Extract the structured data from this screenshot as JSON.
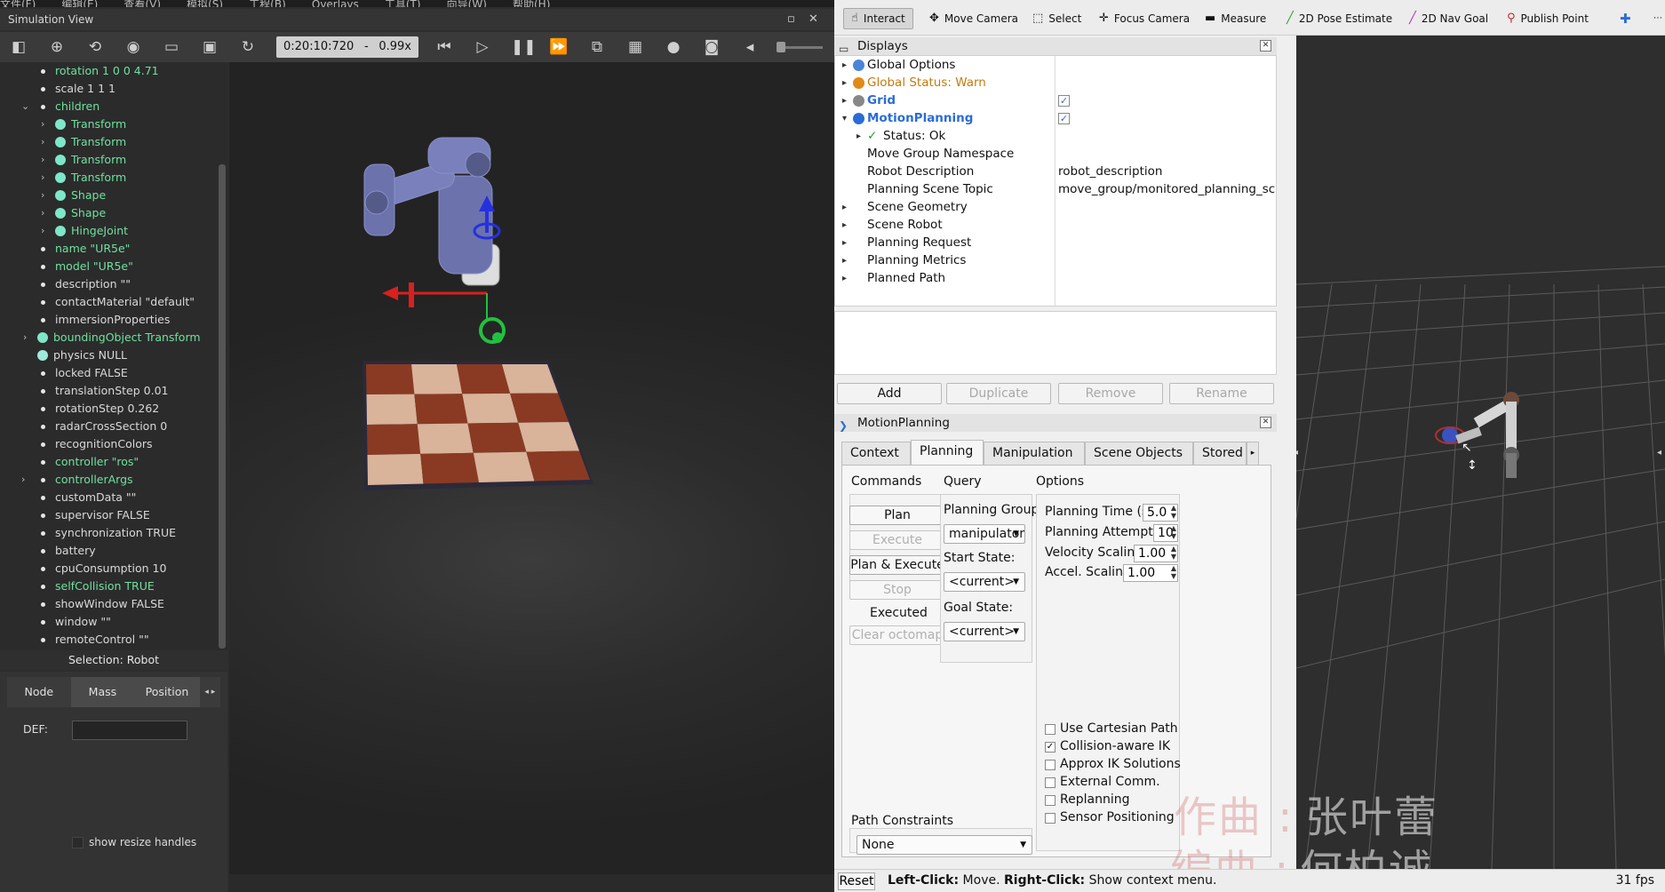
{
  "webots": {
    "title": "Simulation View",
    "menu": [
      "文件(F)",
      "编辑(E)",
      "查看(V)",
      "模拟(S)",
      "工程(B)",
      "Overlays",
      "工具(T)",
      "向导(W)",
      "帮助(H)"
    ],
    "toolbar": {
      "time": "0:20:10:720",
      "separator": "-",
      "speed": "0.99x"
    },
    "scene_tree": [
      {
        "label": "rotation 1 0 0 4.71",
        "green": true,
        "kind": "bullet",
        "indent": 1
      },
      {
        "label": "scale 1 1 1",
        "green": false,
        "kind": "bullet",
        "indent": 1
      },
      {
        "label": "children",
        "green": true,
        "kind": "bullet",
        "indent": 1,
        "expanded": true
      },
      {
        "label": "Transform",
        "green": true,
        "kind": "ball",
        "indent": 2,
        "collapsed": true
      },
      {
        "label": "Transform",
        "green": true,
        "kind": "ball",
        "indent": 2,
        "collapsed": true
      },
      {
        "label": "Transform",
        "green": true,
        "kind": "ball",
        "indent": 2,
        "collapsed": true
      },
      {
        "label": "Transform",
        "green": true,
        "kind": "ball",
        "indent": 2,
        "collapsed": true
      },
      {
        "label": "Shape",
        "green": true,
        "kind": "ball",
        "indent": 2,
        "collapsed": true
      },
      {
        "label": "Shape",
        "green": true,
        "kind": "ball",
        "indent": 2,
        "collapsed": true
      },
      {
        "label": "HingeJoint",
        "green": true,
        "kind": "ball",
        "indent": 2,
        "collapsed": true
      },
      {
        "label": "name \"UR5e\"",
        "green": true,
        "kind": "bullet",
        "indent": 1
      },
      {
        "label": "model \"UR5e\"",
        "green": true,
        "kind": "bullet",
        "indent": 1
      },
      {
        "label": "description \"\"",
        "green": false,
        "kind": "bullet",
        "indent": 1
      },
      {
        "label": "contactMaterial \"default\"",
        "green": false,
        "kind": "bullet",
        "indent": 1
      },
      {
        "label": "immersionProperties",
        "green": false,
        "kind": "bullet",
        "indent": 1
      },
      {
        "label": "boundingObject Transform",
        "green": true,
        "kind": "ball",
        "indent": 0,
        "collapsed": true
      },
      {
        "label": "physics NULL",
        "green": false,
        "kind": "ball",
        "indent": 0
      },
      {
        "label": "locked FALSE",
        "green": false,
        "kind": "bullet",
        "indent": 1
      },
      {
        "label": "translationStep 0.01",
        "green": false,
        "kind": "bullet",
        "indent": 1
      },
      {
        "label": "rotationStep 0.262",
        "green": false,
        "kind": "bullet",
        "indent": 1
      },
      {
        "label": "radarCrossSection 0",
        "green": false,
        "kind": "bullet",
        "indent": 1
      },
      {
        "label": "recognitionColors",
        "green": false,
        "kind": "bullet",
        "indent": 1
      },
      {
        "label": "controller \"ros\"",
        "green": true,
        "kind": "bullet",
        "indent": 1
      },
      {
        "label": "controllerArgs",
        "green": true,
        "kind": "bullet",
        "indent": 1,
        "collapsed": true
      },
      {
        "label": "customData \"\"",
        "green": false,
        "kind": "bullet",
        "indent": 1
      },
      {
        "label": "supervisor FALSE",
        "green": false,
        "kind": "bullet",
        "indent": 1
      },
      {
        "label": "synchronization TRUE",
        "green": false,
        "kind": "bullet",
        "indent": 1
      },
      {
        "label": "battery",
        "green": false,
        "kind": "bullet",
        "indent": 1
      },
      {
        "label": "cpuConsumption 10",
        "green": false,
        "kind": "bullet",
        "indent": 1
      },
      {
        "label": "selfCollision TRUE",
        "green": true,
        "kind": "bullet",
        "indent": 1
      },
      {
        "label": "showWindow FALSE",
        "green": false,
        "kind": "bullet",
        "indent": 1
      },
      {
        "label": "window \"\"",
        "green": false,
        "kind": "bullet",
        "indent": 1
      },
      {
        "label": "remoteControl \"\"",
        "green": false,
        "kind": "bullet",
        "indent": 1
      }
    ],
    "selection_label": "Selection: Robot",
    "field_editor": {
      "tabs": [
        "Node",
        "Mass",
        "Position"
      ],
      "def_label": "DEF:",
      "def_value": "",
      "show_resize_handles": "show resize handles"
    }
  },
  "rviz": {
    "tools": [
      {
        "label": "Interact",
        "icon": "hand-icon",
        "active": true
      },
      {
        "label": "Move Camera",
        "icon": "move-camera-icon",
        "active": false
      },
      {
        "label": "Select",
        "icon": "select-icon",
        "active": false
      },
      {
        "label": "Focus Camera",
        "icon": "focus-camera-icon",
        "active": false
      },
      {
        "label": "Measure",
        "icon": "measure-icon",
        "active": false
      },
      {
        "label": "2D Pose Estimate",
        "icon": "pose-estimate-icon",
        "active": false
      },
      {
        "label": "2D Nav Goal",
        "icon": "nav-goal-icon",
        "active": false
      },
      {
        "label": "Publish Point",
        "icon": "publish-point-icon",
        "active": false
      }
    ],
    "displays": {
      "title": "Displays",
      "rows": [
        {
          "label": "Global Options",
          "value": ""
        },
        {
          "label": "Global Status: Warn",
          "value": ""
        },
        {
          "label": "Grid",
          "value": "",
          "checked": true
        },
        {
          "label": "MotionPlanning",
          "value": "",
          "checked": true
        },
        {
          "label": "Status: Ok",
          "value": ""
        },
        {
          "label": "Move Group Namespace",
          "value": ""
        },
        {
          "label": "Robot Description",
          "value": "robot_description"
        },
        {
          "label": "Planning Scene Topic",
          "value": "move_group/monitored_planning_sc"
        },
        {
          "label": "Scene Geometry",
          "value": ""
        },
        {
          "label": "Scene Robot",
          "value": ""
        },
        {
          "label": "Planning Request",
          "value": ""
        },
        {
          "label": "Planning Metrics",
          "value": ""
        },
        {
          "label": "Planned Path",
          "value": ""
        }
      ],
      "buttons": {
        "add": "Add",
        "duplicate": "Duplicate",
        "remove": "Remove",
        "rename": "Rename"
      }
    },
    "motion_planning": {
      "title": "MotionPlanning",
      "tabs": [
        "Context",
        "Planning",
        "Manipulation",
        "Scene Objects",
        "Stored"
      ],
      "active_tab": "Planning",
      "commands": {
        "title": "Commands",
        "plan": "Plan",
        "execute": "Execute",
        "plan_execute": "Plan & Execute",
        "stop": "Stop",
        "status": "Executed",
        "clear_octomap": "Clear octomap"
      },
      "query": {
        "title": "Query",
        "group_label": "Planning Group:",
        "group_value": "manipulator",
        "start_label": "Start State:",
        "start_value": "<current>",
        "goal_label": "Goal State:",
        "goal_value": "<current>"
      },
      "options": {
        "title": "Options",
        "planning_time_label": "Planning Time (s):",
        "planning_time": "5.0",
        "attempts_label": "Planning Attempts:",
        "attempts": "10",
        "velocity_label": "Velocity Scaling:",
        "velocity": "1.00",
        "accel_label": "Accel. Scaling:",
        "accel": "1.00",
        "checks": [
          {
            "label": "Use Cartesian Path",
            "checked": false
          },
          {
            "label": "Collision-aware IK",
            "checked": true
          },
          {
            "label": "Approx IK Solutions",
            "checked": false
          },
          {
            "label": "External Comm.",
            "checked": false
          },
          {
            "label": "Replanning",
            "checked": false
          },
          {
            "label": "Sensor Positioning",
            "checked": false
          }
        ]
      },
      "path_constraints": {
        "label": "Path Constraints",
        "value": "None"
      }
    },
    "status": {
      "reset": "Reset",
      "left_click": "Left-Click:",
      "left_action": " Move. ",
      "right_click": "Right-Click:",
      "right_action": " Show context menu.",
      "fps": "31 fps"
    }
  },
  "overlay": {
    "line1_a": "作曲",
    "line1_sep": ":",
    "line1_b": "张叶蕾",
    "line2_a": "编曲",
    "line2_sep": ":",
    "line2_b": "何柏诚"
  }
}
